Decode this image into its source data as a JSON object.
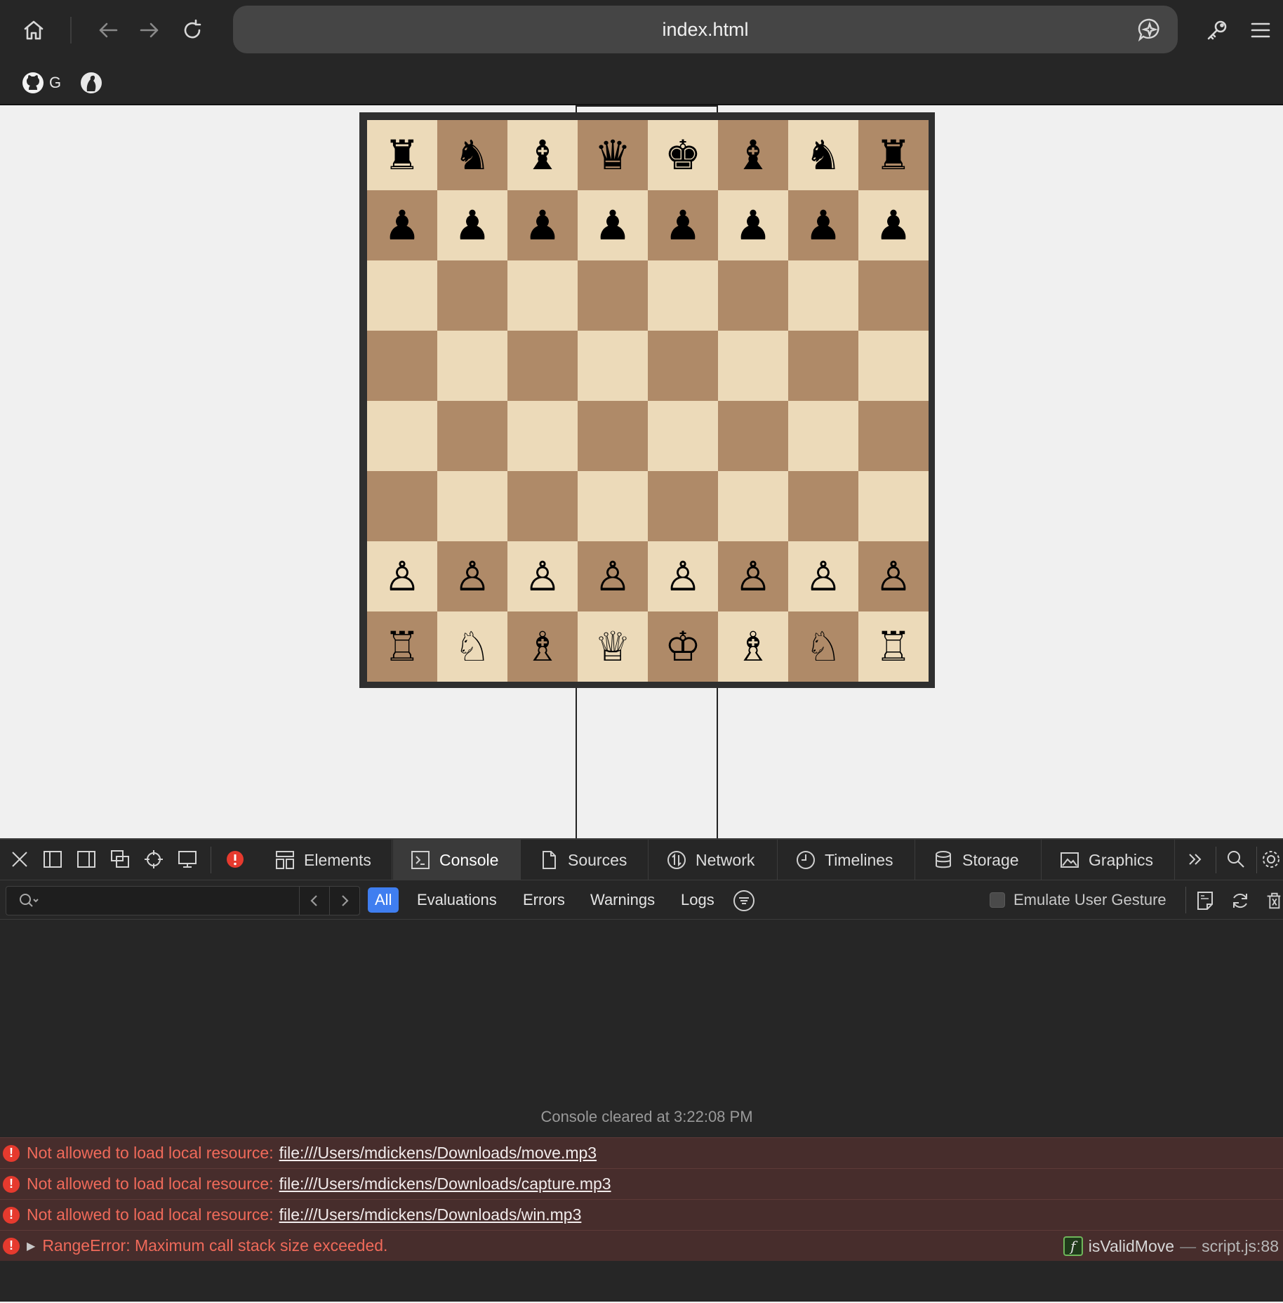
{
  "browser": {
    "address": "index.html",
    "bookmarks": [
      {
        "icon": "github-icon",
        "label": "G"
      },
      {
        "icon": "site-icon",
        "label": ""
      }
    ]
  },
  "board": {
    "light_color": "#ecdab9",
    "dark_color": "#af8a68",
    "frame_color": "#2f2f2f",
    "rows": [
      [
        "♜",
        "♞",
        "♝",
        "♛",
        "♚",
        "♝",
        "♞",
        "♜"
      ],
      [
        "♟",
        "♟",
        "♟",
        "♟",
        "♟",
        "♟",
        "♟",
        "♟"
      ],
      [
        "",
        "",
        "",
        "",
        "",
        "",
        "",
        ""
      ],
      [
        "",
        "",
        "",
        "",
        "",
        "",
        "",
        ""
      ],
      [
        "",
        "",
        "",
        "",
        "",
        "",
        "",
        ""
      ],
      [
        "",
        "",
        "",
        "",
        "",
        "",
        "",
        ""
      ],
      [
        "♙",
        "♙",
        "♙",
        "♙",
        "♙",
        "♙",
        "♙",
        "♙"
      ],
      [
        "♖",
        "♘",
        "♗",
        "♕",
        "♔",
        "♗",
        "♘",
        "♖"
      ]
    ]
  },
  "devtools": {
    "tabs": [
      "Elements",
      "Console",
      "Sources",
      "Network",
      "Timelines",
      "Storage",
      "Graphics"
    ],
    "active_tab": "Console",
    "filter_levels": [
      "All",
      "Evaluations",
      "Errors",
      "Warnings",
      "Logs"
    ],
    "active_level": "All",
    "emulate_label": "Emulate User Gesture",
    "cleared_text": "Console cleared at 3:22:08 PM",
    "messages": [
      {
        "text": "Not allowed to load local resource:",
        "link": "file:///Users/mdickens/Downloads/move.mp3"
      },
      {
        "text": "Not allowed to load local resource:",
        "link": "file:///Users/mdickens/Downloads/capture.mp3"
      },
      {
        "text": "Not allowed to load local resource:",
        "link": "file:///Users/mdickens/Downloads/win.mp3"
      }
    ],
    "range_error": {
      "text": "RangeError: Maximum call stack size exceeded.",
      "function": "isValidMove",
      "separator": "—",
      "location": "script.js:88"
    },
    "error_color": "#e63a2e",
    "accent_color": "#3f7ef0"
  }
}
